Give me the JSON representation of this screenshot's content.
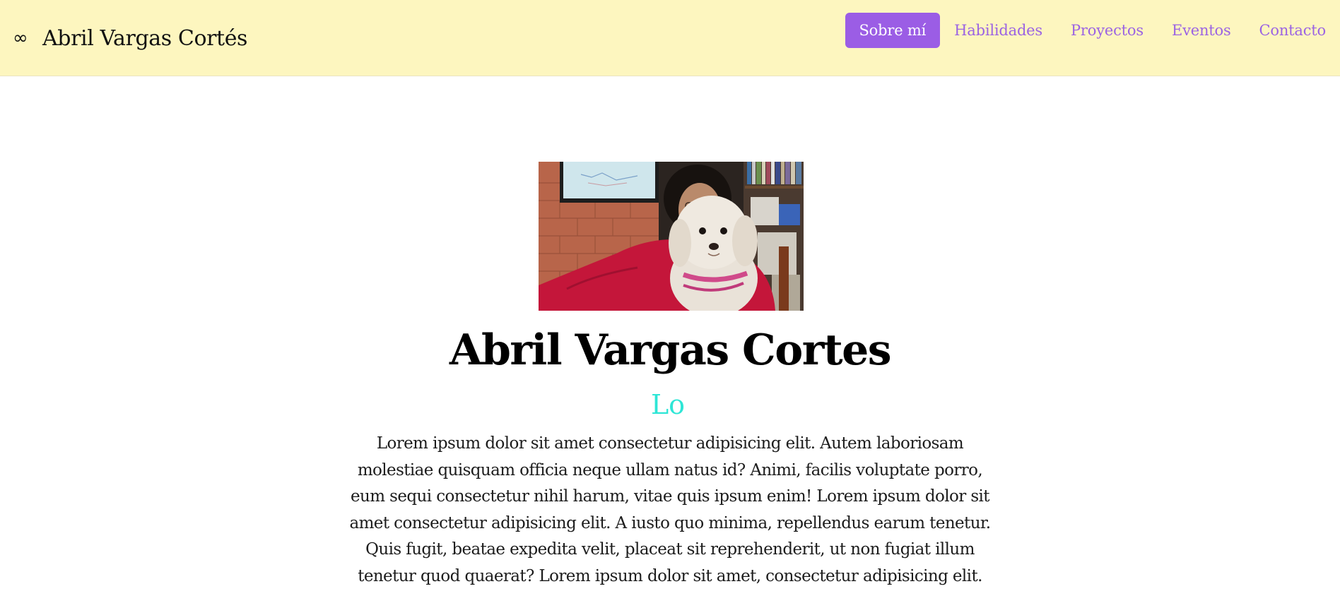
{
  "navbar": {
    "brand_icon": "∞",
    "brand_name": "Abril Vargas Cortés",
    "links": [
      {
        "label": "Sobre mí",
        "active": true
      },
      {
        "label": "Habilidades",
        "active": false
      },
      {
        "label": "Proyectos",
        "active": false
      },
      {
        "label": "Eventos",
        "active": false
      },
      {
        "label": "Contacto",
        "active": false
      }
    ]
  },
  "hero": {
    "photo_icon": "profile-photo",
    "name": "Abril Vargas Cortes",
    "typed_text": "Lo",
    "bio": "Lorem ipsum dolor sit amet consectetur adipisicing elit. Autem laboriosam molestiae quisquam officia neque ullam natus id? Animi, facilis voluptate porro, eum sequi consectetur nihil harum, vitae quis ipsum enim! Lorem ipsum dolor sit amet consectetur adipisicing elit. A iusto quo minima, repellendus earum tenetur. Quis fugit, beatae expedita velit, placeat sit reprehenderit, ut non fugiat illum tenetur quod quaerat? Lorem ipsum dolor sit amet, consectetur adipisicing elit."
  },
  "colors": {
    "navbar_bg": "#fdf6bf",
    "accent_purple": "#9b5de5",
    "link_purple": "#9b63e3",
    "typed_cyan": "#2ee6d6"
  }
}
